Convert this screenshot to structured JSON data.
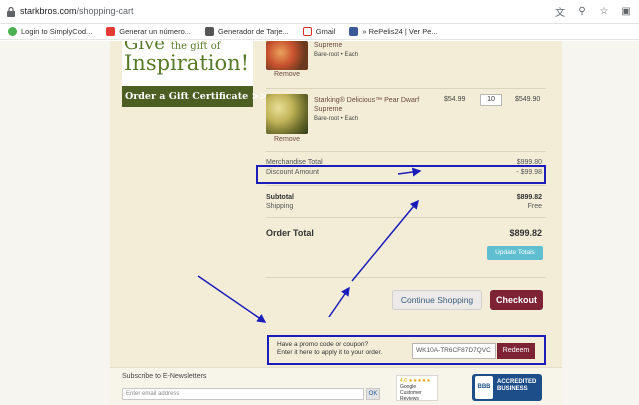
{
  "browser": {
    "url_host": "starkbros.com",
    "url_path": "/shopping-cart",
    "bookmarks": [
      {
        "label": "Login to SimplyCod...",
        "color": "#4caf50"
      },
      {
        "label": "Generar un número...",
        "color": "#e53935"
      },
      {
        "label": "Generador de Tarje...",
        "color": "#555555"
      },
      {
        "label": "Gmail",
        "color": "#d93025"
      },
      {
        "label": "» RePelis24 | Ver Pe...",
        "color": "#3b5998"
      }
    ]
  },
  "promo": {
    "give": "Give",
    "gift_of": "the gift of",
    "inspiration": "Inspiration!",
    "order_gift": "Order a Gift Certificate >>"
  },
  "items": [
    {
      "name": "Supreme",
      "meta": "Bare-root  •  Each",
      "remove": "Remove"
    },
    {
      "name_line1": "Starking® Delicious™ Pear Dwarf",
      "name_line2": "Supreme",
      "meta": "Bare-root  •  Each",
      "unit_price": "$54.99",
      "qty": "10",
      "line_total": "$549.90",
      "remove": "Remove"
    }
  ],
  "summary": {
    "merch_label": "Merchandise Total",
    "merch_value": "$999.80",
    "discount_label": "Discount Amount",
    "discount_value": "- $99.98",
    "subtotal_label": "Subtotal",
    "subtotal_value": "$899.82",
    "shipping_label": "Shipping",
    "shipping_value": "Free",
    "order_total_label": "Order Total",
    "order_total_value": "$899.82"
  },
  "buttons": {
    "update_totals": "Update Totals",
    "continue_shopping": "Continue Shopping",
    "checkout": "Checkout",
    "redeem": "Redeem"
  },
  "promo_code": {
    "line1": "Have a promo code or coupon?",
    "line2": "Enter it here to apply it to your order.",
    "value": "WK10A-TR6CF87D7QVC"
  },
  "footer": {
    "newsletter_label": "Subscribe to E-Newsletters",
    "email_placeholder": "Enter email address",
    "ok": "OK",
    "google_rating": "4.6 ★★★★★",
    "google_line1": "Google",
    "google_line2": "Customer Reviews",
    "bbb_logo": "BBB",
    "bbb_line1": "ACCREDITED",
    "bbb_line2": "BUSINESS"
  },
  "colors": {
    "annotation": "#1a1dba",
    "checkout": "#7e2236",
    "update": "#5fbfd1"
  }
}
